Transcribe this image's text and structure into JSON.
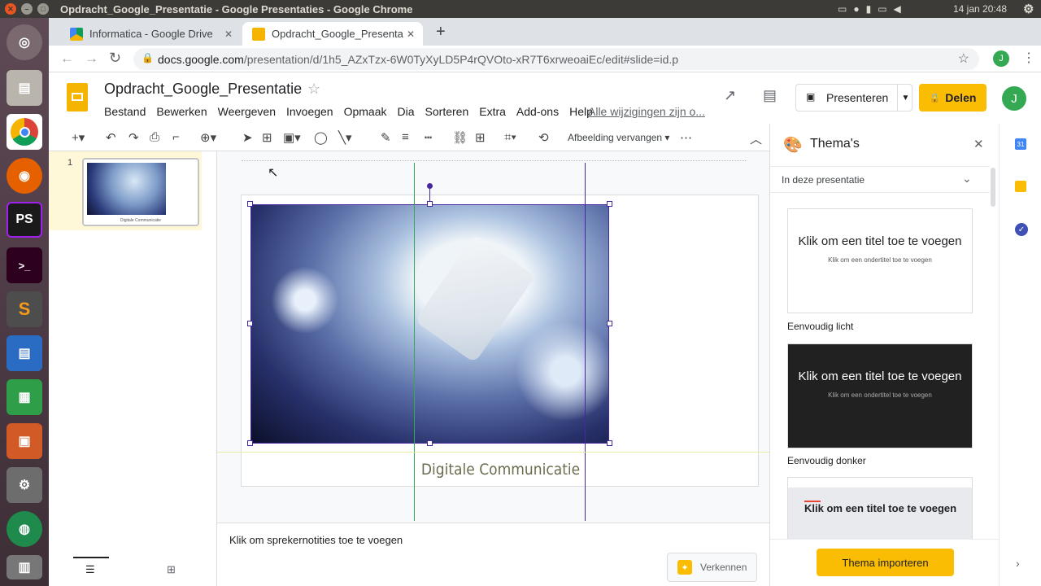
{
  "window": {
    "title": "Opdracht_Google_Presentatie - Google Presentaties - Google Chrome",
    "clock": "14 jan 20:48"
  },
  "tabs": [
    {
      "label": "Informatica - Google Drive"
    },
    {
      "label": "Opdracht_Google_Presentatie"
    }
  ],
  "url": {
    "host": "docs.google.com",
    "path": "/presentation/d/1h5_AZxTzx-6W0TyXyLD5P4rQVOto-xR7T6xrweoaiEc/edit#slide=id.p"
  },
  "doc": {
    "title": "Opdracht_Google_Presentatie",
    "saved": "Alle wijzigingen zijn o...",
    "menu": [
      "Bestand",
      "Bewerken",
      "Weergeven",
      "Invoegen",
      "Opmaak",
      "Dia",
      "Sorteren",
      "Extra",
      "Add-ons",
      "Help"
    ]
  },
  "header": {
    "present": "Presenteren",
    "share": "Delen",
    "avatar": "J"
  },
  "toolbar": {
    "replace_image": "Afbeelding vervangen"
  },
  "slide": {
    "number": "1",
    "caption": "Digitale Communicatie",
    "thumb_caption": "Digitale Communicatie"
  },
  "notes": {
    "placeholder": "Klik om sprekernotities toe te voegen",
    "explore": "Verkennen"
  },
  "themes": {
    "title": "Thema's",
    "section": "In deze presentatie",
    "import": "Thema importeren",
    "items": [
      {
        "title": "Klik om een titel toe te voegen",
        "subtitle": "Klik om een ondertitel toe te voegen",
        "name": "Eenvoudig licht"
      },
      {
        "title": "Klik om een titel toe te voegen",
        "subtitle": "Klik om een ondertitel toe te voegen",
        "name": "Eenvoudig donker"
      },
      {
        "title": "Klik om een titel toe te voegen"
      }
    ]
  },
  "colors": {
    "accent": "#fbbc04",
    "selection": "#4527a0",
    "guide_green": "#34a853"
  }
}
